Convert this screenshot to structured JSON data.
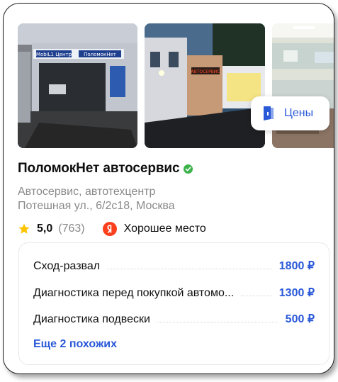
{
  "business": {
    "name": "ПоломокНет автосервис",
    "category": "Автосервис, автотехцентр",
    "address": "Потешная ул., 6/2с18, Москва",
    "rating": "5,0",
    "reviews_count": "(763)",
    "badge": "Хорошее место"
  },
  "photos": {
    "prices_label": "Цены",
    "sign1": "MobiL1 Центр",
    "sign2": "ПоломокНет",
    "sign3": "АВТОСЕРВИС"
  },
  "services": [
    {
      "name": "Сход-развал",
      "price": "1800 ₽"
    },
    {
      "name": "Диагностика перед покупкой автомо...",
      "price": "1300 ₽"
    },
    {
      "name": "Диагностика подвески",
      "price": "500 ₽"
    }
  ],
  "more_link": "Еще 2 похожих",
  "colors": {
    "accent": "#2a59d8",
    "verified": "#3bb34a",
    "star": "#fcc400",
    "yandex": "#fc3f1d"
  }
}
